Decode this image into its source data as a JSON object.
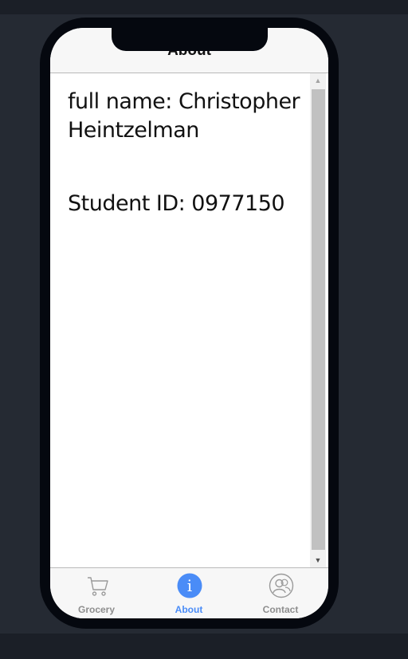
{
  "header": {
    "title": "About"
  },
  "content": {
    "full_name": "full name: Christopher Heintzelman",
    "student_id": "Student ID: 0977150"
  },
  "tabs": [
    {
      "label": "Grocery",
      "icon": "cart-icon",
      "active": false
    },
    {
      "label": "About",
      "icon": "info-icon",
      "active": true
    },
    {
      "label": "Contact",
      "icon": "contact-icon",
      "active": false
    }
  ],
  "colors": {
    "accent": "#4a8cf7",
    "inactive_tab": "#8e8e8e",
    "background": "#252a33",
    "device_frame": "#05080f"
  }
}
